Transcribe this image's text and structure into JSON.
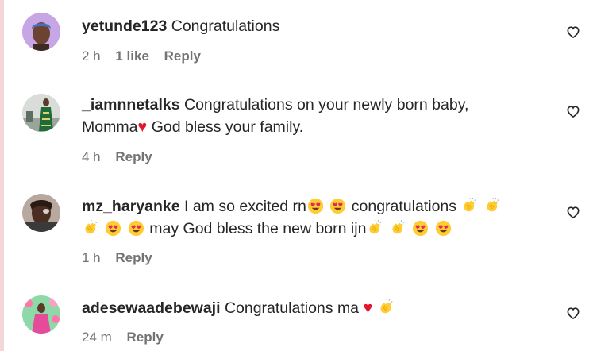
{
  "comments": [
    {
      "username": "yetunde123",
      "segments": [
        "Congratulations"
      ],
      "time": "2 h",
      "likes": "1 like",
      "reply": "Reply"
    },
    {
      "username": "_iamnnetalks",
      "segments": [
        "Congratulations on your newly born baby,",
        "Momma",
        "God bless your family."
      ],
      "time": "4 h",
      "reply": "Reply"
    },
    {
      "username": "mz_haryanke",
      "segments": [
        "I am so excited rn",
        "congratulations",
        "may God bless the new born ijn"
      ],
      "time": "1 h",
      "reply": "Reply"
    },
    {
      "username": "adesewaadebewaji",
      "segments": [
        "Congratulations ma"
      ],
      "time": "24 m",
      "reply": "Reply"
    }
  ],
  "icons": {
    "like_button": "heart-outline-icon",
    "emoji_heart": "red-heart-emoji",
    "emoji_heart_eyes": "heart-eyes-emoji",
    "emoji_clap": "clapping-hands-emoji"
  },
  "colors": {
    "text": "#262626",
    "secondary": "#737373",
    "heart": "#e3162e",
    "emoji_yellow": "#ffcc33"
  }
}
